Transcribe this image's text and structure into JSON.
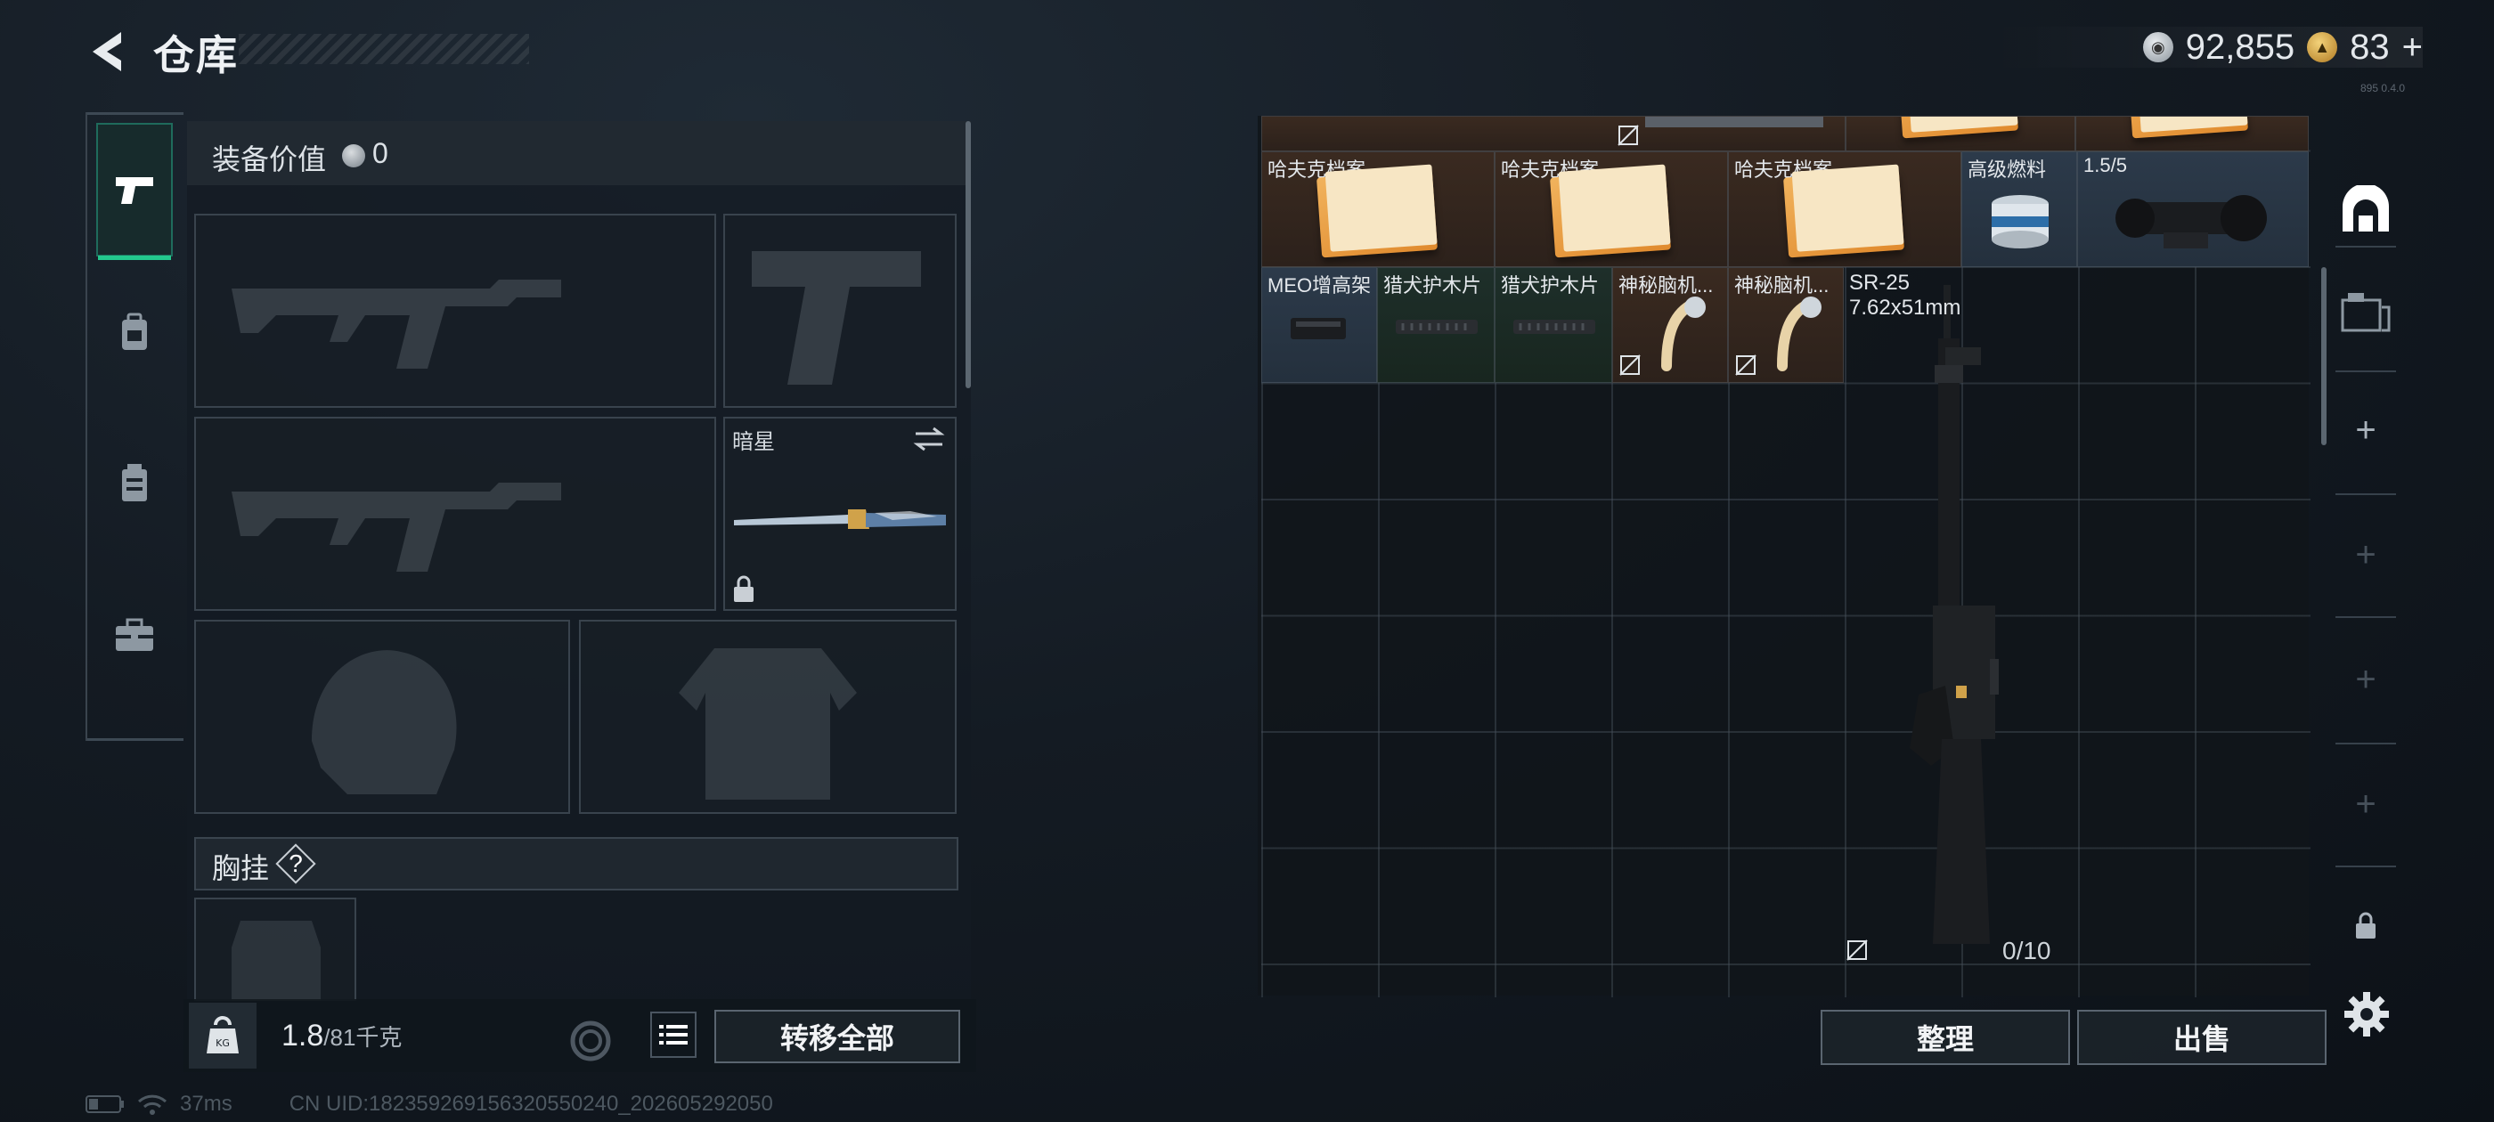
{
  "header": {
    "title": "仓库",
    "currency_silver": "92,855",
    "currency_gold": "83",
    "currency_gold_add": "+",
    "version": "895 0.4.0"
  },
  "side_nav": {
    "items": [
      {
        "icon": "pistol-icon",
        "active": true
      },
      {
        "icon": "backpack-icon",
        "active": false
      },
      {
        "icon": "rig-icon",
        "active": false
      },
      {
        "icon": "toolbox-icon",
        "active": false
      }
    ]
  },
  "equipment": {
    "value_label": "装备价值",
    "value": "0",
    "melee_name": "暗星",
    "chest_label": "胸挂",
    "chest_help": "?"
  },
  "bottom_left": {
    "weight_current": "1.8",
    "weight_max": "/81千克",
    "transfer_all": "转移全部"
  },
  "status": {
    "ping": "37ms",
    "uid": "CN UID:18235926915632055024​0_202605292050"
  },
  "stash": {
    "row1": [
      {
        "label": "哈夫克档案",
        "type": "brown"
      },
      {
        "label": "哈夫克档案",
        "type": "brown"
      },
      {
        "label": "哈夫克档案",
        "type": "brown"
      },
      {
        "label": "高级燃料",
        "type": "blue"
      },
      {
        "label": "1.5/5",
        "type": "blue"
      }
    ],
    "row2": [
      {
        "label": "MEO增高架",
        "type": "blue"
      },
      {
        "label": "猎犬护木片",
        "type": "green"
      },
      {
        "label": "猎犬护木片",
        "type": "green"
      },
      {
        "label": "神秘脑机...",
        "type": "brown"
      },
      {
        "label": "神秘脑机...",
        "type": "brown"
      }
    ],
    "weapon_name": "SR-25",
    "weapon_caliber": "7.62x51mm",
    "weapon_ammo": "0/10",
    "sort_button": "整理",
    "sell_button": "出售"
  },
  "colors": {
    "accent_green": "#23c98d",
    "folder_orange": "#e08a2d"
  }
}
